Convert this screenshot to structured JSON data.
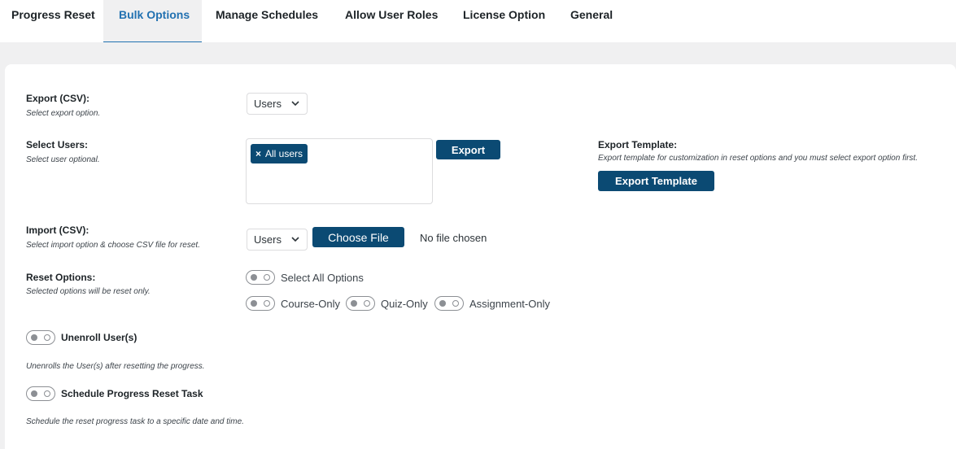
{
  "tabs": [
    {
      "label": "Progress Reset",
      "active": false
    },
    {
      "label": "Bulk Options",
      "active": true
    },
    {
      "label": "Manage Schedules",
      "active": false
    },
    {
      "label": "Allow User Roles",
      "active": false
    },
    {
      "label": "License Option",
      "active": false
    },
    {
      "label": "General",
      "active": false
    }
  ],
  "export_csv": {
    "title": "Export (CSV):",
    "desc": "Select export option.",
    "selected": "Users"
  },
  "select_users": {
    "title": "Select Users:",
    "desc": "Select user optional.",
    "chip_remove": "×",
    "chip_label": "All users",
    "export_button": "Export"
  },
  "export_template": {
    "title": "Export Template:",
    "desc": "Export template for customization in reset options and you must select export option first.",
    "button": "Export Template"
  },
  "import_csv": {
    "title": "Import (CSV):",
    "desc": "Select import option & choose CSV file for reset.",
    "selected": "Users",
    "choose_file": "Choose File",
    "no_file": "No file chosen"
  },
  "reset_options": {
    "title": "Reset Options:",
    "desc": "Selected options will be reset only.",
    "select_all": "Select All Options",
    "course_only": "Course-Only",
    "quiz_only": "Quiz-Only",
    "assignment_only": "Assignment-Only"
  },
  "unenroll": {
    "label": "Unenroll User(s)",
    "desc": "Unenrolls the User(s) after resetting the progress."
  },
  "schedule": {
    "label": "Schedule Progress Reset Task",
    "desc": "Schedule the reset progress task to a specific date and time."
  },
  "colors": {
    "primary": "#0b4a73",
    "active_tab": "#2271b1",
    "background": "#f0f0f1"
  }
}
